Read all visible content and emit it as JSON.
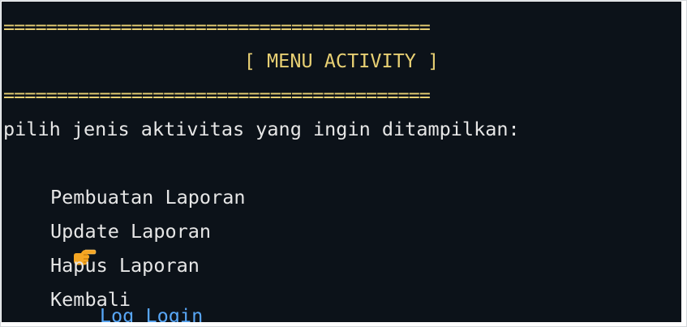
{
  "terminal": {
    "rule_top": "========================================",
    "title": "[ MENU ACTIVITY ]",
    "rule_bottom": "========================================",
    "prompt": "pilih jenis aktivitas yang ingin ditampilkan:",
    "menu": [
      {
        "label": "Log Login",
        "selected": true
      },
      {
        "label": "Pembuatan Laporan",
        "selected": false
      },
      {
        "label": "Update Laporan",
        "selected": false
      },
      {
        "label": "Hapus Laporan",
        "selected": false
      },
      {
        "label": "Kembali",
        "selected": false
      }
    ],
    "pointer_icon": "pointing-hand-icon",
    "colors": {
      "background": "#0c1219",
      "rule": "#e7cf73",
      "text": "#e6e6e6",
      "selected": "#58a6f5",
      "pointer": "#f5a623"
    }
  }
}
